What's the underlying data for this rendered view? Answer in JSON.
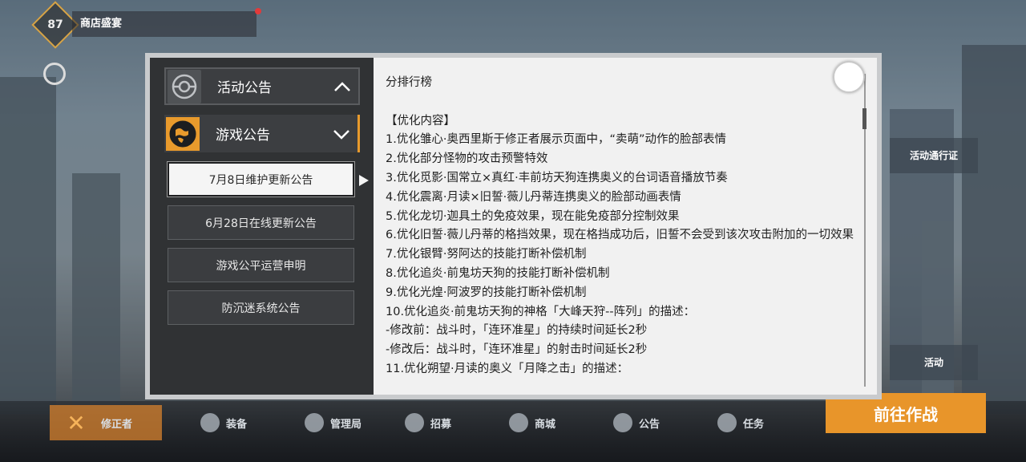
{
  "background": {
    "badge_level": "87",
    "badge_label": "商店盛宴",
    "bottom_nav": [
      "修正者",
      "装备",
      "管理局",
      "招募",
      "商城",
      "公告",
      "任务"
    ],
    "right_button": "前往作战",
    "side_cards": [
      "活动通行证",
      "活动",
      "活动"
    ]
  },
  "modal": {
    "categories": [
      {
        "label": "活动公告",
        "icon": "eye-emblem-icon",
        "expanded": false,
        "chevron": "up"
      },
      {
        "label": "游戏公告",
        "icon": "globe-emblem-icon",
        "expanded": true,
        "chevron": "down",
        "accent": "#e89a2c"
      }
    ],
    "announcements": [
      {
        "label": "7月8日维护更新公告",
        "active": true
      },
      {
        "label": "6月28日在线更新公告",
        "active": false
      },
      {
        "label": "游戏公平运营申明",
        "active": false
      },
      {
        "label": "防沉迷系统公告",
        "active": false
      }
    ],
    "content": {
      "heading": "分排行榜",
      "section_title": "【优化内容】",
      "lines": [
        "1.优化雏心·奥西里斯于修正者展示页面中，“卖萌”动作的脸部表情",
        "2.优化部分怪物的攻击预警特效",
        "3.优化觅影·国常立×真红·丰前坊天狗连携奥义的台词语音播放节奏",
        "4.优化震离·月读×旧誓·薇儿丹蒂连携奥义的脸部动画表情",
        "5.优化龙切·迦具土的免疫效果，现在能免疫部分控制效果",
        "6.优化旧誓·薇儿丹蒂的格挡效果，现在格挡成功后，旧誓不会受到该次攻击附加的一切效果",
        "7.优化银臂·努阿达的技能打断补偿机制",
        "8.优化追炎·前鬼坊天狗的技能打断补偿机制",
        "9.优化光煌·阿波罗的技能打断补偿机制",
        "10.优化追炎·前鬼坊天狗的神格「大峰天狩--阵列」的描述：",
        "-修改前：战斗时，「连环准星」的持续时间延长2秒",
        "-修改后：战斗时，「连环准星」的射击时间延长2秒",
        "11.优化朔望·月读的奥义「月降之击」的描述："
      ]
    }
  },
  "colors": {
    "accent": "#e89a2c",
    "panel_dark": "#303234",
    "panel_light": "#f1f1f1"
  }
}
